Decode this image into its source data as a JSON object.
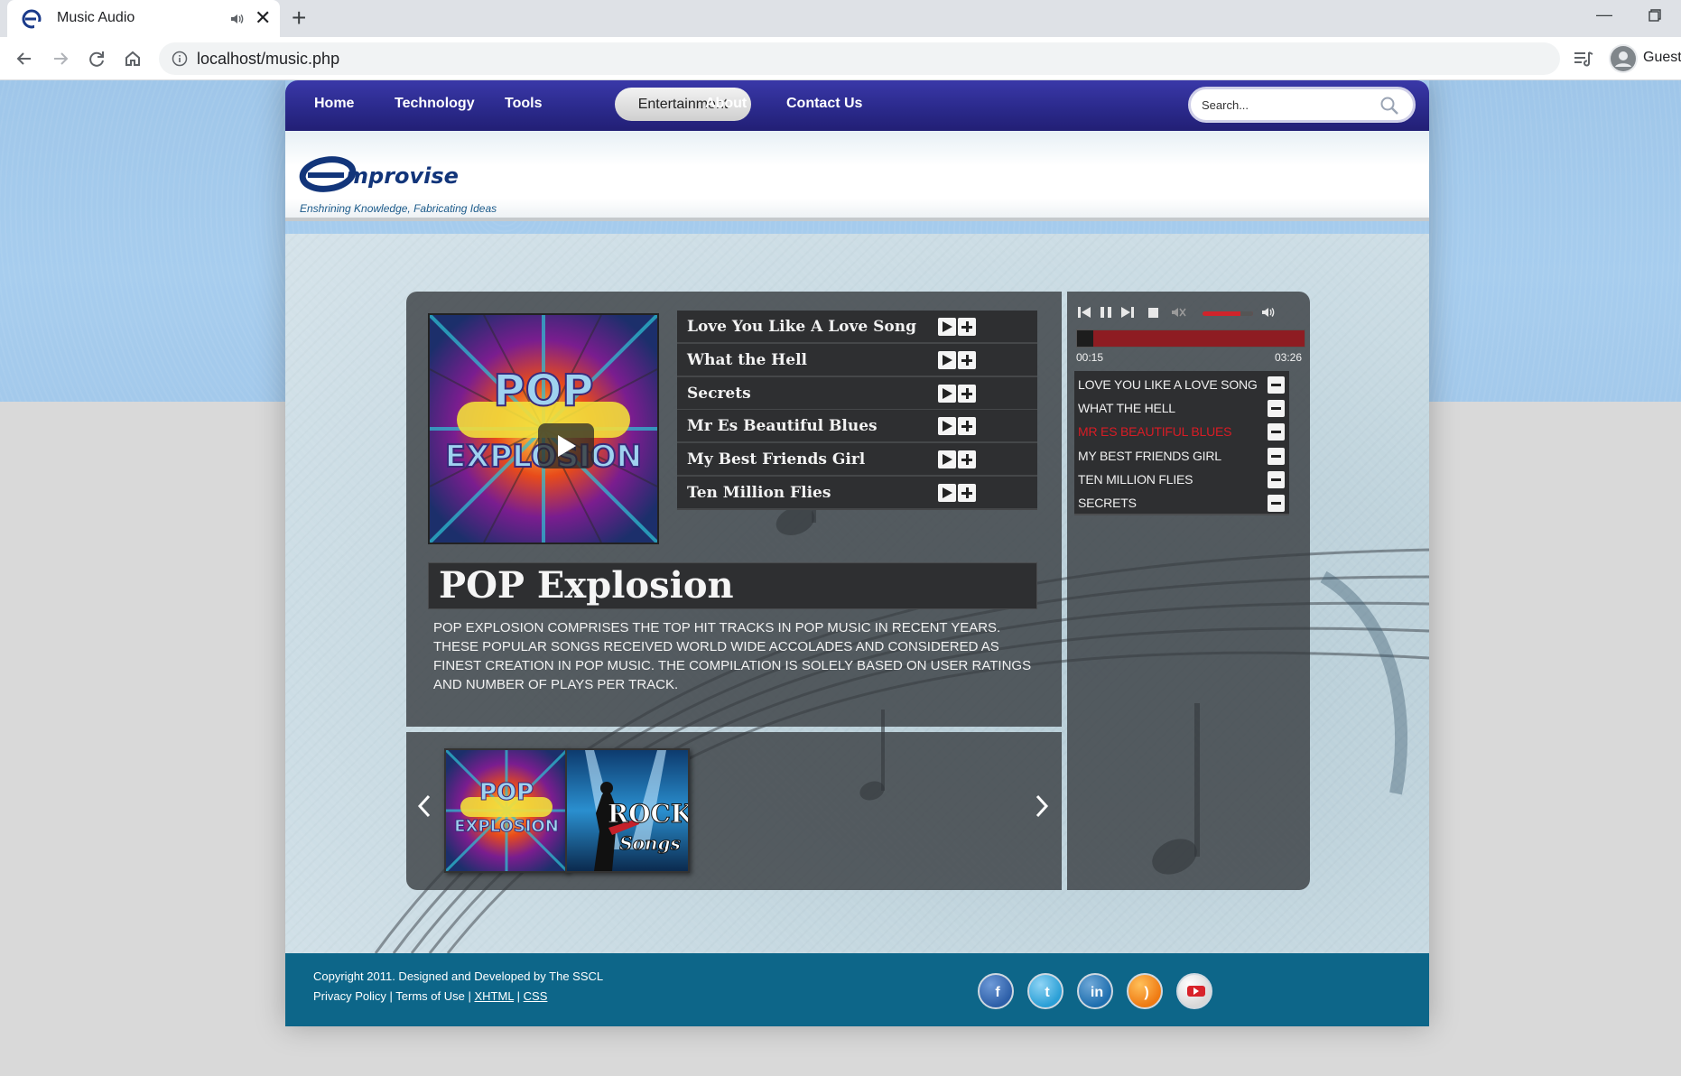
{
  "browser": {
    "tab_title": "Music Audio",
    "tab_audio_icon": "speaker-icon",
    "new_tab_symbol": "+",
    "close_symbol": "✕",
    "url": "localhost/music.php",
    "profile_label": "Guest"
  },
  "site": {
    "nav": {
      "items": [
        "Home",
        "Technology",
        "Tools",
        "Entertainment",
        "About",
        "Contact Us"
      ],
      "active": "Entertainment"
    },
    "search": {
      "placeholder": "Search..."
    },
    "logo_text": "Emprovise",
    "tagline": "Enshrining Knowledge, Fabricating Ideas"
  },
  "album": {
    "title": "POP Explosion",
    "cover_label": "POP EXPLOSION",
    "description": "POP EXPLOSION COMPRISES THE TOP HIT TRACKS IN POP MUSIC IN RECENT YEARS. THESE POPULAR SONGS RECEIVED WORLD WIDE ACCOLADES AND CONSIDERED AS FINEST CREATION IN POP MUSIC. THE COMPILATION IS SOLELY BASED ON USER RATINGS AND NUMBER OF PLAYS PER TRACK.",
    "tracks": [
      "Love You Like A Love Song",
      "What the Hell",
      "Secrets",
      "Mr Es Beautiful Blues",
      "My Best Friends Girl",
      "Ten Million Flies"
    ]
  },
  "carousel": {
    "albums": [
      {
        "label": "POP EXPLOSION",
        "id": "pop"
      },
      {
        "label_top": "ROCK",
        "label_bottom": "Songs",
        "id": "rock"
      }
    ]
  },
  "player": {
    "elapsed": "00:15",
    "total": "03:26",
    "progress": 0.073,
    "volume": 0.75,
    "playlist": [
      {
        "name": "Love You Like A Love Song",
        "active": false
      },
      {
        "name": "What The Hell",
        "active": false
      },
      {
        "name": "Mr Es Beautiful Blues",
        "active": true
      },
      {
        "name": "My Best Friends Girl",
        "active": false
      },
      {
        "name": "Ten Million Flies",
        "active": false
      },
      {
        "name": "Secrets",
        "active": false
      }
    ],
    "colors": {
      "accent": "#d0242b",
      "active_text": "#d81c25"
    }
  },
  "footer": {
    "copyright": "Copyright 2011. Designed and Developed by The SSCL",
    "links": [
      "Privacy Policy",
      "Terms of Use",
      "XHTML",
      "CSS"
    ],
    "social": [
      "facebook-icon",
      "twitter-icon",
      "linkedin-icon",
      "rss-icon",
      "youtube-icon"
    ]
  }
}
